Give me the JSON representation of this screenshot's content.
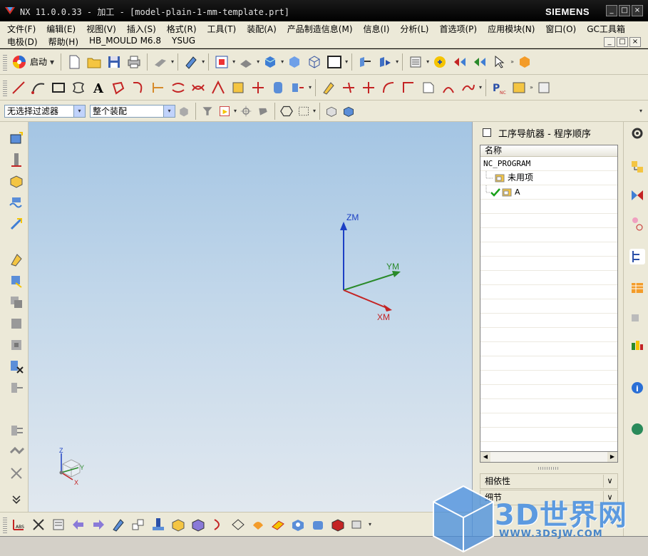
{
  "window": {
    "title": "NX 11.0.0.33 - 加工 - [model-plain-1-mm-template.prt]",
    "brand": "SIEMENS",
    "controls": [
      "_",
      "□",
      "×"
    ]
  },
  "menu": {
    "row1": [
      "文件(F)",
      "编辑(E)",
      "视图(V)",
      "插入(S)",
      "格式(R)",
      "工具(T)",
      "装配(A)",
      "产品制造信息(M)",
      "信息(I)",
      "分析(L)",
      "首选项(P)",
      "应用模块(N)",
      "窗口(O)",
      "GC工具箱"
    ],
    "row2": [
      "电极(D)",
      "帮助(H)",
      "HB_MOULD M6.8",
      "YSUG"
    ],
    "mdi_controls": [
      "_",
      "□",
      "×"
    ]
  },
  "toolbar": {
    "start_label": "启动",
    "filter_value": "无选择过滤器",
    "scope_value": "整个装配",
    "overflow": "»",
    "drop": "▾"
  },
  "navigator": {
    "title": "工序导航器 - 程序顺序",
    "column": "名称",
    "rows": [
      {
        "label": "NC_PROGRAM",
        "indent": 0,
        "icon": "none"
      },
      {
        "label": "未用项",
        "indent": 1,
        "icon": "folder-icon"
      },
      {
        "label": "A",
        "indent": 1,
        "icon": "program-group-icon",
        "check": true
      }
    ],
    "sections": [
      "相依性",
      "细节"
    ]
  },
  "viewport": {
    "axes": {
      "z": "ZM",
      "y": "YM",
      "x": "XM"
    },
    "triad": {
      "z": "Z",
      "y": "Y",
      "x": "X"
    }
  },
  "watermark": {
    "text": "3D世界网",
    "url": "WWW.3DSJW.COM"
  },
  "colors": {
    "axis_z": "#1c3fc4",
    "axis_y": "#2a8a2a",
    "axis_x": "#c42424",
    "check": "#19a119"
  }
}
